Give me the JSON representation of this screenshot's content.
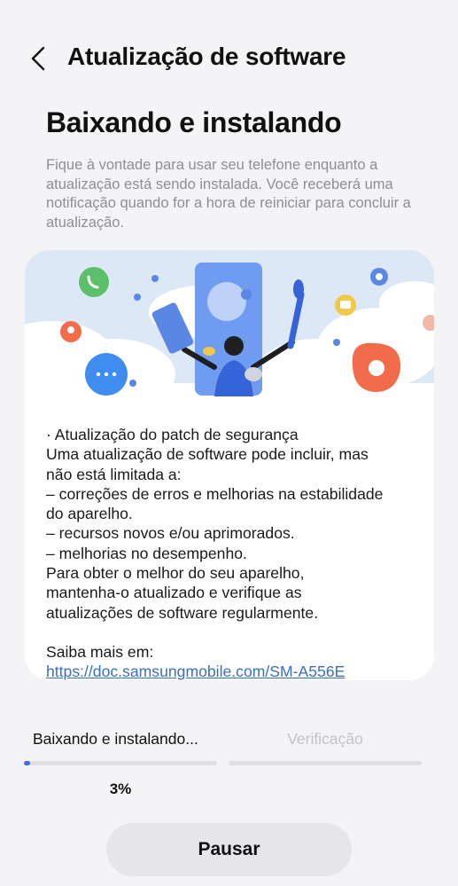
{
  "header": {
    "back_icon": "chevron-left-icon",
    "title": "Atualização de software"
  },
  "status": {
    "headline": "Baixando e instalando",
    "description": "Fique à vontade para usar seu telefone enquanto a atualização está sendo instalada. Você receberá uma notificação quando for a hora de reiniciar para concluir a atualização."
  },
  "release_notes": {
    "lines": [
      "· Atualização do patch de segurança",
      "Uma atualização de software pode incluir, mas",
      "não está limitada a:",
      " – correções de erros e melhorias na estabilidade",
      "do aparelho.",
      " – recursos novos e/ou aprimorados.",
      " – melhorias no desempenho.",
      "Para obter o melhor do seu aparelho,",
      "mantenha-o atualizado e verifique as",
      "atualizações de software regularmente."
    ],
    "learn_more_label": "Saiba mais em:",
    "learn_more_link": "https://doc.samsungmobile.com/SM-A556E"
  },
  "progress": {
    "step_1_label": "Baixando e instalando...",
    "step_2_label": "Verificação",
    "step_1_fraction": 0.03,
    "step_2_fraction": 0,
    "percent_text": "3%",
    "accent_color": "#3d6fe0"
  },
  "actions": {
    "pause_label": "Pausar"
  }
}
